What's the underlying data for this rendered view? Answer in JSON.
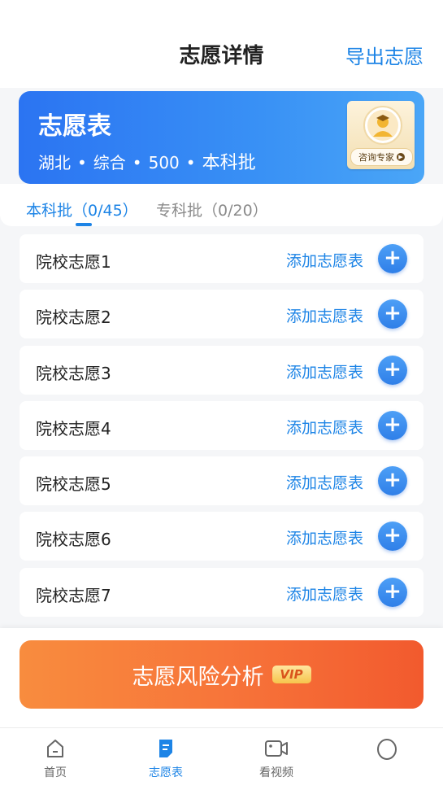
{
  "header": {
    "title": "志愿详情",
    "export_label": "导出志愿"
  },
  "card": {
    "title": "志愿表",
    "province": "湖北",
    "subject": "综合",
    "score": "500",
    "batch": "本科批",
    "separator": "•",
    "expert_label": "咨询专家"
  },
  "tabs": [
    {
      "label": "本科批（0/45）",
      "active": true
    },
    {
      "label": "专科批（0/20）",
      "active": false
    }
  ],
  "list": {
    "items": [
      {
        "label": "院校志愿1",
        "action": "添加志愿表"
      },
      {
        "label": "院校志愿2",
        "action": "添加志愿表"
      },
      {
        "label": "院校志愿3",
        "action": "添加志愿表"
      },
      {
        "label": "院校志愿4",
        "action": "添加志愿表"
      },
      {
        "label": "院校志愿5",
        "action": "添加志愿表"
      },
      {
        "label": "院校志愿6",
        "action": "添加志愿表"
      },
      {
        "label": "院校志愿7",
        "action": "添加志愿表"
      }
    ]
  },
  "risk": {
    "label": "志愿风险分析",
    "badge": "VIP"
  },
  "tabbar": [
    {
      "label": "首页",
      "icon": "home-icon"
    },
    {
      "label": "志愿表",
      "icon": "document-icon"
    },
    {
      "label": "看视频",
      "icon": "video-icon"
    },
    {
      "label": "",
      "icon": "profile-icon"
    }
  ],
  "colors": {
    "accent": "#1d84e6",
    "card": "#2b74f2",
    "risk": "#f7753a"
  }
}
